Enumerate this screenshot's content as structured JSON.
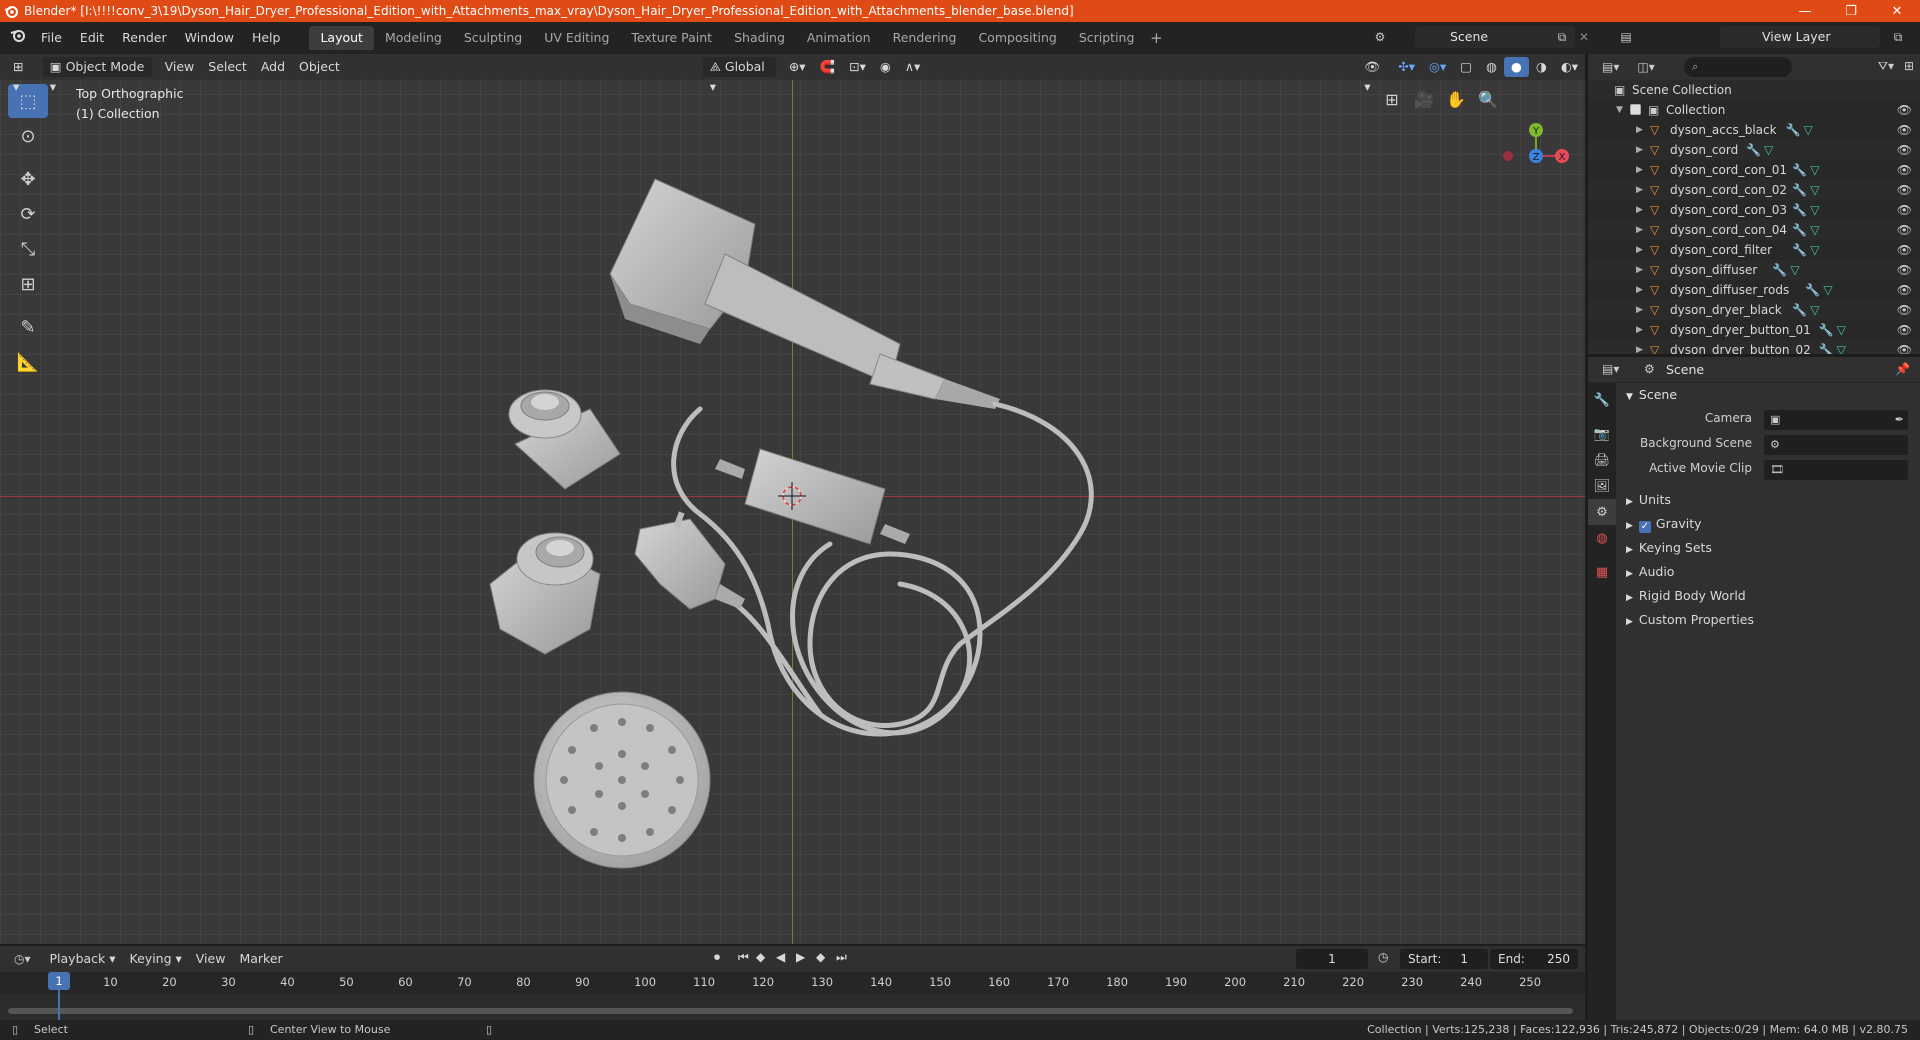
{
  "window": {
    "title": "Blender* [I:\\!!!!conv_3\\19\\Dyson_Hair_Dryer_Professional_Edition_with_Attachments_max_vray\\Dyson_Hair_Dryer_Professional_Edition_with_Attachments_blender_base.blend]",
    "minimize": "—",
    "maximize": "❐",
    "close": "✕"
  },
  "menu": [
    "File",
    "Edit",
    "Render",
    "Window",
    "Help"
  ],
  "workspaces": [
    "Layout",
    "Modeling",
    "Sculpting",
    "UV Editing",
    "Texture Paint",
    "Shading",
    "Animation",
    "Rendering",
    "Compositing",
    "Scripting"
  ],
  "active_workspace": "Layout",
  "scene_name": "Scene",
  "view_layer": "View Layer",
  "viewport": {
    "mode": "Object Mode",
    "menus": [
      "View",
      "Select",
      "Add",
      "Object"
    ],
    "transform": "Global",
    "view_name": "Top Orthographic",
    "collection_info": "(1) Collection",
    "gizmo": {
      "x": "X",
      "y": "Y",
      "z": "Z"
    }
  },
  "outliner": {
    "root": "Scene Collection",
    "collection": "Collection",
    "items": [
      "dyson_accs_black",
      "dyson_cord",
      "dyson_cord_con_01",
      "dyson_cord_con_02",
      "dyson_cord_con_03",
      "dyson_cord_con_04",
      "dyson_cord_filter",
      "dyson_diffuser",
      "dyson_diffuser_rods",
      "dyson_dryer_black",
      "dyson_dryer_button_01",
      "dyson_dryer_button_02"
    ]
  },
  "properties": {
    "context": "Scene",
    "panel": "Scene",
    "fields": [
      {
        "label": "Camera",
        "value": ""
      },
      {
        "label": "Background Scene",
        "value": ""
      },
      {
        "label": "Active Movie Clip",
        "value": ""
      }
    ],
    "subpanels": [
      "Units",
      "Gravity",
      "Keying Sets",
      "Audio",
      "Rigid Body World",
      "Custom Properties"
    ]
  },
  "timeline": {
    "menus": [
      "Playback",
      "Keying",
      "View",
      "Marker"
    ],
    "current_frame": "1",
    "start_label": "Start:",
    "start": "1",
    "end_label": "End:",
    "end": "250",
    "ticks": [
      "1",
      "10",
      "20",
      "30",
      "40",
      "50",
      "60",
      "70",
      "80",
      "90",
      "100",
      "110",
      "120",
      "130",
      "140",
      "150",
      "160",
      "170",
      "180",
      "190",
      "200",
      "210",
      "220",
      "230",
      "240",
      "250"
    ]
  },
  "status": {
    "left_action": "Select",
    "mid_action": "Center View to Mouse",
    "stats": "Collection | Verts:125,238 | Faces:122,936 | Tris:245,872 | Objects:0/29 | Mem: 64.0 MB | v2.80.75"
  }
}
